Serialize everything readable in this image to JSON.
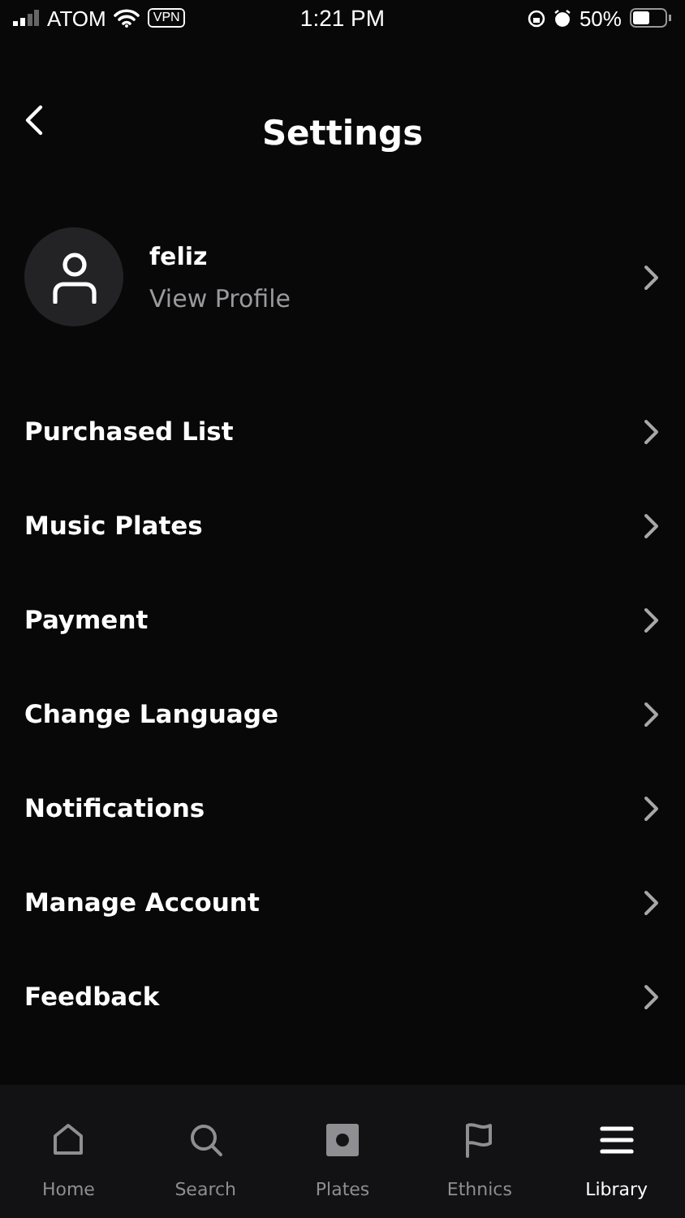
{
  "status_bar": {
    "carrier": "ATOM",
    "vpn": "VPN",
    "time": "1:21 PM",
    "battery": "50%"
  },
  "header": {
    "title": "Settings"
  },
  "profile": {
    "name": "feliz",
    "link": "View Profile"
  },
  "menu": [
    {
      "label": "Purchased List"
    },
    {
      "label": "Music Plates"
    },
    {
      "label": "Payment"
    },
    {
      "label": "Change Language"
    },
    {
      "label": "Notifications"
    },
    {
      "label": "Manage Account"
    },
    {
      "label": "Feedback"
    }
  ],
  "tabs": [
    {
      "label": "Home",
      "kind": "home",
      "selected": false
    },
    {
      "label": "Search",
      "kind": "search",
      "selected": false
    },
    {
      "label": "Plates",
      "kind": "plates",
      "selected": false
    },
    {
      "label": "Ethnics",
      "kind": "flag",
      "selected": false
    },
    {
      "label": "Library",
      "kind": "library",
      "selected": true
    }
  ]
}
